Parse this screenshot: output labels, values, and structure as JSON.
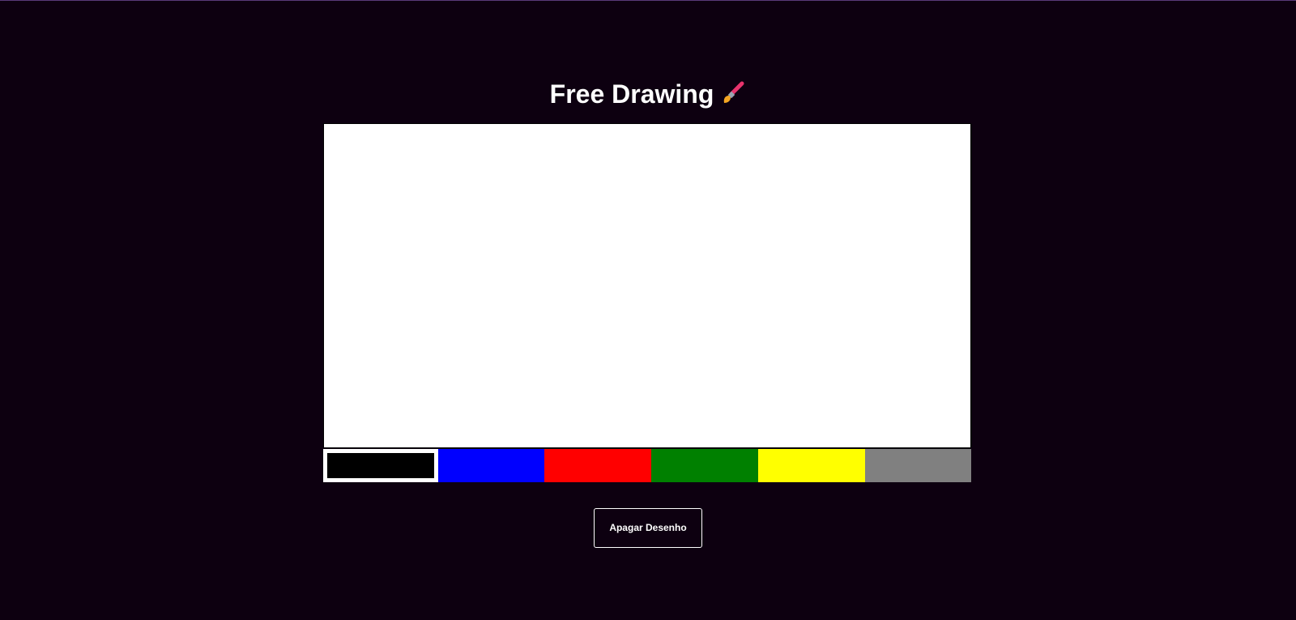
{
  "header": {
    "title": "Free Drawing",
    "icon": "paintbrush-icon"
  },
  "canvas": {
    "background": "#ffffff"
  },
  "palette": {
    "colors": [
      {
        "name": "black",
        "hex": "#000000",
        "selected": true
      },
      {
        "name": "blue",
        "hex": "#0000ff",
        "selected": false
      },
      {
        "name": "red",
        "hex": "#ff0000",
        "selected": false
      },
      {
        "name": "green",
        "hex": "#008000",
        "selected": false
      },
      {
        "name": "yellow",
        "hex": "#ffff00",
        "selected": false
      },
      {
        "name": "gray",
        "hex": "#808080",
        "selected": false
      }
    ]
  },
  "actions": {
    "clear_label": "Apagar Desenho"
  },
  "theme": {
    "page_background": "#0d0010",
    "text": "#ffffff"
  }
}
